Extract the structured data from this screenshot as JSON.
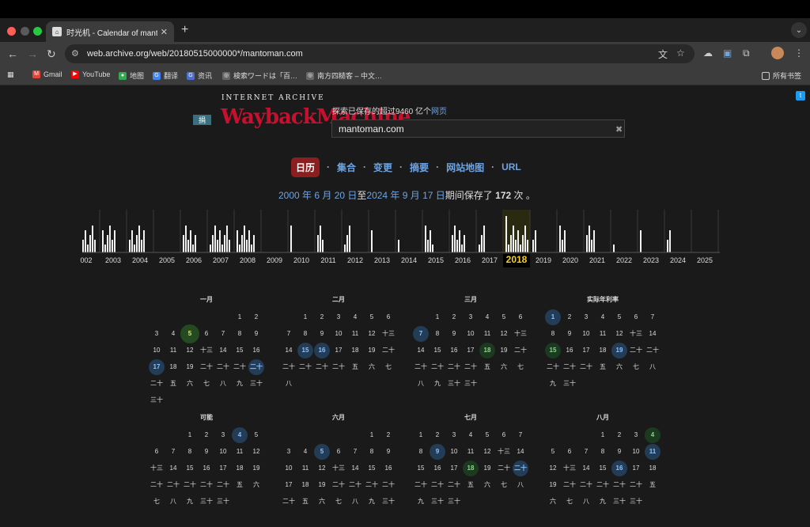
{
  "browser": {
    "tab_title": "时光机 - Calendar of mantom",
    "url": "web.archive.org/web/20180515000000*/mantoman.com",
    "bookmarks": [
      "Gmail",
      "YouTube",
      "地图",
      "翻译",
      "资讯",
      "検索ワードは「百…",
      "南方四糙客 – 中文…"
    ],
    "bookmarks_folder": "所有书签"
  },
  "wayback": {
    "donate": "捐",
    "logo_top": "INTERNET ARCHIVE",
    "logo_main": "WaybackMachine",
    "explore_text": "探索已保存的超过9460 亿个",
    "explore_link": "网页",
    "search_value": "mantoman.com",
    "tabs": [
      "日历",
      "集合",
      "变更",
      "摘要",
      "网站地图",
      "URL"
    ],
    "saved_from": "2000 年 6 月 20 日",
    "saved_mid": "至",
    "saved_to": "2024 年 9 月 17 日",
    "saved_mid2": "期间保存了",
    "saved_count": "172",
    "saved_unit": "次 。"
  },
  "chart_data": {
    "type": "bar",
    "title": "",
    "categories": [
      "002",
      "2003",
      "2004",
      "2005",
      "2006",
      "2007",
      "2008",
      "2009",
      "2010",
      "2011",
      "2012",
      "2013",
      "2014",
      "2015",
      "2016",
      "2017",
      "2018",
      "2019",
      "2020",
      "2021",
      "2022",
      "2023",
      "2024",
      "2025"
    ],
    "selected": "2018",
    "series": [
      {
        "values": [
          9,
          6,
          7,
          0,
          6,
          9,
          8,
          0,
          1,
          3,
          3,
          1,
          1,
          4,
          6,
          3,
          14,
          2,
          3,
          4,
          1,
          1,
          2,
          0
        ]
      }
    ],
    "grid": true
  },
  "months": [
    {
      "name": "一月",
      "start": 5,
      "days": 31,
      "caps": [
        5,
        17,
        23
      ],
      "green": [
        5
      ],
      "big": [
        5
      ]
    },
    {
      "name": "二月",
      "start": 1,
      "days": 28,
      "caps": [
        15,
        16
      ],
      "green": [],
      "big": []
    },
    {
      "name": "三月",
      "start": 1,
      "days": 31,
      "caps": [
        7,
        18
      ],
      "green": [
        18
      ],
      "big": []
    },
    {
      "name": "实际年利率",
      "start": 0,
      "days": 30,
      "caps": [
        1,
        15,
        19
      ],
      "green": [
        15
      ],
      "big": []
    },
    {
      "name": "可能",
      "start": 2,
      "days": 31,
      "caps": [
        4
      ],
      "green": [],
      "big": []
    },
    {
      "name": "六月",
      "start": 5,
      "days": 30,
      "caps": [
        5
      ],
      "green": [],
      "big": []
    },
    {
      "name": "七月",
      "start": 0,
      "days": 31,
      "caps": [
        9,
        18,
        21
      ],
      "green": [
        18
      ],
      "big": []
    },
    {
      "name": "八月",
      "start": 3,
      "days": 31,
      "caps": [
        4,
        11,
        16
      ],
      "green": [
        4
      ],
      "big": []
    }
  ],
  "day_labels": {
    "13": "十三",
    "20": "二十",
    "21": "二十",
    "22": "二十",
    "23": "二十",
    "24": "二十",
    "25": "五",
    "26": "六",
    "27": "七",
    "28": "八",
    "29": "九",
    "30": "三十",
    "31": "三十"
  },
  "colors": {
    "accent": "#6fa3e0",
    "active_tab": "#8b1e1e",
    "year_selected": "#f7d11e"
  }
}
